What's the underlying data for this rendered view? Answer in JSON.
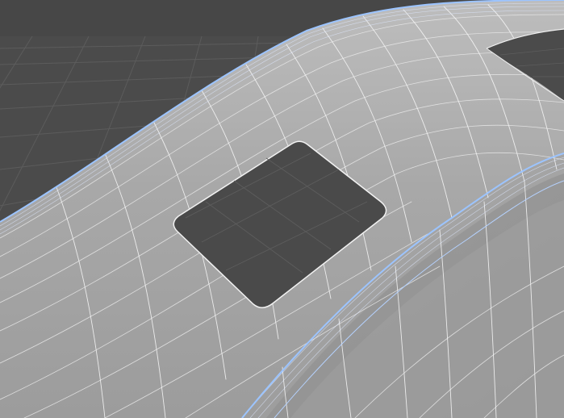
{
  "viewport": {
    "kind": "3d-modeling-viewport",
    "shading": "wireframe-on-shaded",
    "colors": {
      "background": "#474747",
      "floor_grid": "#5b5b5b",
      "surface_light": "#b6b6b6",
      "surface_mid": "#a2a2a2",
      "surface_dark": "#8e8e8e",
      "wire_white": "#f0f0f0",
      "wire_edge": "#9cc4ff",
      "hole_fill": "#4a4a4a"
    },
    "icons": {
      "floor": "floor-grid-icon",
      "mesh": "mesh-surface-icon",
      "hole": "rounded-rect-hole-icon"
    }
  }
}
